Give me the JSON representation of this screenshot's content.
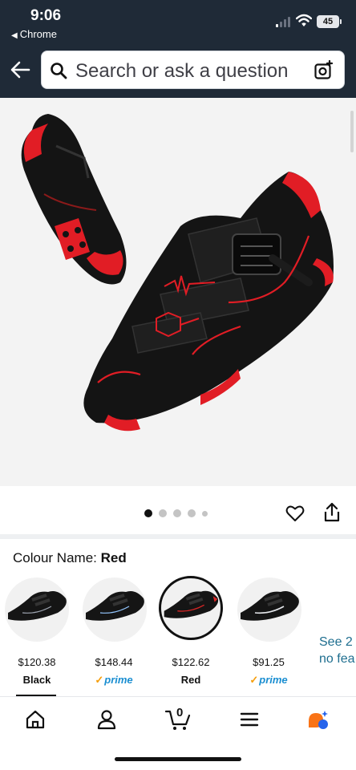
{
  "status_bar": {
    "time": "9:06",
    "back_app": "Chrome",
    "battery": "45"
  },
  "search": {
    "placeholder": "Search or ask a question"
  },
  "gallery": {
    "dot_count": 5,
    "active_index": 0
  },
  "colour": {
    "label": "Colour Name:",
    "selected": "Red"
  },
  "variants": [
    {
      "price": "$120.38",
      "name": "Black",
      "prime": false,
      "selected": false,
      "accent": "#9ca3af"
    },
    {
      "price": "$148.44",
      "name": "",
      "prime": true,
      "selected": false,
      "accent": "#93c5fd"
    },
    {
      "price": "$122.62",
      "name": "Red",
      "prime": false,
      "selected": true,
      "accent": "#dc2626"
    },
    {
      "price": "$91.25",
      "name": "",
      "prime": true,
      "selected": false,
      "accent": "#e5e7eb"
    }
  ],
  "prime_label": "prime",
  "see_more": {
    "line1": "See 2",
    "line2": "no fea"
  },
  "nav": [
    "home-icon",
    "account-icon",
    "cart-icon",
    "menu-icon",
    "rufus-icon"
  ],
  "cart_count": "0",
  "colors": {
    "header": "#1f2a37",
    "accent_red": "#e11d25",
    "link": "#1e6e8f"
  }
}
